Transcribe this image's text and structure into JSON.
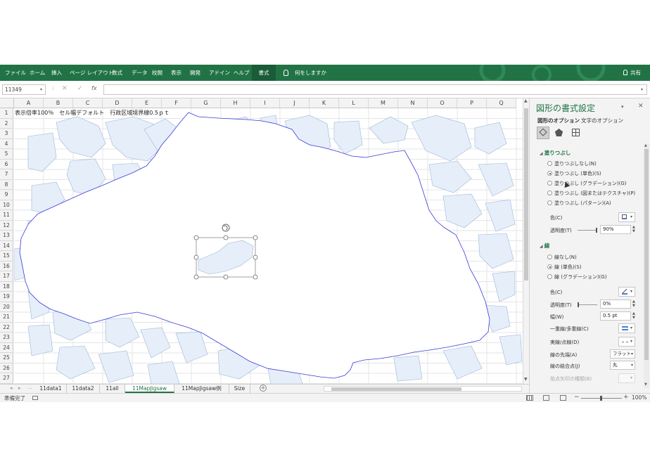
{
  "ribbon": {
    "tabs": [
      "ファイル",
      "ホーム",
      "挿入",
      "ページ レイアウト",
      "数式",
      "データ",
      "校閲",
      "表示",
      "開発",
      "アドイン",
      "ヘルプ",
      "書式"
    ],
    "active_tab": "書式",
    "tell_me": "何をしますか",
    "share": "共有"
  },
  "formula_bar": {
    "name_box": "11349",
    "fx": "fx"
  },
  "grid": {
    "columns": [
      "A",
      "B",
      "C",
      "D",
      "E",
      "F",
      "G",
      "H",
      "I",
      "J",
      "K",
      "L",
      "M",
      "N",
      "O",
      "P",
      "Q"
    ],
    "rows": [
      "1",
      "2",
      "3",
      "4",
      "5",
      "6",
      "7",
      "8",
      "9",
      "10",
      "11",
      "12",
      "13",
      "14",
      "15",
      "16",
      "17",
      "18",
      "19",
      "20",
      "21",
      "22",
      "23",
      "24",
      "25",
      "26",
      "27"
    ],
    "cell_a1": "表示倍率100％　セル幅デフォルト　行政区域境界線0.5ｐｔ"
  },
  "sheet_tabs": [
    "11data1",
    "11data2",
    "11all",
    "11MapJigsaw",
    "11MapJigsaw例",
    "Size"
  ],
  "active_sheet": "11MapJigsaw",
  "status": {
    "ready": "準備完了",
    "zoom": "100%"
  },
  "format_pane": {
    "title": "図形の書式設定",
    "tab_shape": "図形のオプション",
    "tab_text": "文字のオプション",
    "fill_section": "塗りつぶし",
    "fill_options": [
      "塗りつぶしなし(N)",
      "塗りつぶし (単色)(S)",
      "塗りつぶし (グラデーション)(G)",
      "塗りつぶし (図またはテクスチャ)(P)",
      "塗りつぶし (パターン)(A)"
    ],
    "fill_selected": 1,
    "fill_color_label": "色(C)",
    "fill_transparency_label": "透明度(T)",
    "fill_transparency": "90%",
    "line_section": "線",
    "line_options": [
      "線なし(N)",
      "線 (単色)(S)",
      "線 (グラデーション)(G)"
    ],
    "line_selected": 1,
    "line_color_label": "色(C)",
    "line_transparency_label": "透明度(T)",
    "line_transparency": "0%",
    "width_label": "幅(W)",
    "width": "0.5 pt",
    "compound_label": "一重線/多重線(C)",
    "dash_label": "実線/点線(D)",
    "cap_label": "線の先端(A)",
    "cap": "フラット",
    "join_label": "線の結合点(J)",
    "join": "丸",
    "arrow_label": "始点矢印の種類(B)"
  },
  "colors": {
    "accent": "#217346",
    "boundary": "#3a3ad6",
    "fill": "#e6eefa",
    "piece_border": "#8fb0d4"
  }
}
